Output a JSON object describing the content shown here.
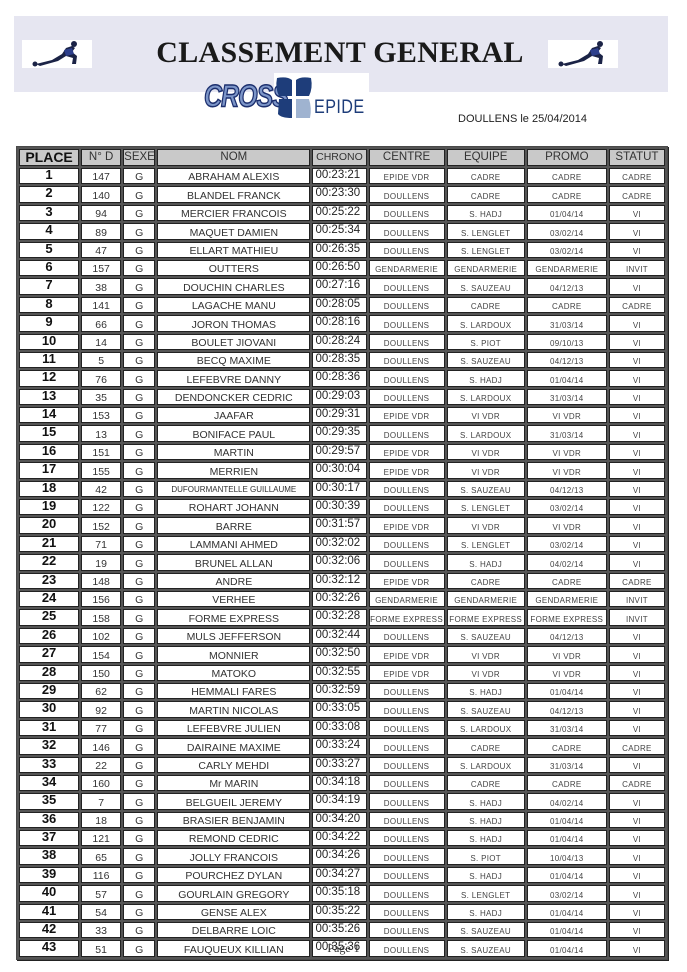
{
  "header": {
    "title": "CLASSEMENT GENERAL",
    "logo_text_cross": "CROSS",
    "logo_text_epide": "EPIDE",
    "location_date": "DOULLENS le 25/04/2014",
    "left_image": "runner-stretch-image",
    "right_image": "runner-stretch-image"
  },
  "colors": {
    "banner": "#e6e6f1",
    "header_cell": "#c9c9c9",
    "epide_dark_blue": "#1e3d7a",
    "epide_light_blue": "#9fb3d0",
    "cross_fill": "#7c95c8"
  },
  "table": {
    "columns": [
      "PLACE",
      "N° D",
      "SEXE",
      "NOM",
      "CHRONO",
      "CENTRE",
      "EQUIPE",
      "PROMO",
      "STATUT"
    ],
    "rows": [
      {
        "place": "1",
        "nd": "147",
        "sexe": "G",
        "nom": "ABRAHAM ALEXIS",
        "chrono": "00:23:21",
        "centre": "EPIDE VDR",
        "equipe": "CADRE",
        "promo": "CADRE",
        "statut": "CADRE"
      },
      {
        "place": "2",
        "nd": "140",
        "sexe": "G",
        "nom": "BLANDEL FRANCK",
        "chrono": "00:23:30",
        "centre": "DOULLENS",
        "equipe": "CADRE",
        "promo": "CADRE",
        "statut": "CADRE"
      },
      {
        "place": "3",
        "nd": "94",
        "sexe": "G",
        "nom": "MERCIER FRANCOIS",
        "chrono": "00:25:22",
        "centre": "DOULLENS",
        "equipe": "S. HADJ",
        "promo": "01/04/14",
        "statut": "VI"
      },
      {
        "place": "4",
        "nd": "89",
        "sexe": "G",
        "nom": "MAQUET DAMIEN",
        "chrono": "00:25:34",
        "centre": "DOULLENS",
        "equipe": "S. LENGLET",
        "promo": "03/02/14",
        "statut": "VI"
      },
      {
        "place": "5",
        "nd": "47",
        "sexe": "G",
        "nom": "ELLART MATHIEU",
        "chrono": "00:26:35",
        "centre": "DOULLENS",
        "equipe": "S. LENGLET",
        "promo": "03/02/14",
        "statut": "VI"
      },
      {
        "place": "6",
        "nd": "157",
        "sexe": "G",
        "nom": "OUTTERS",
        "chrono": "00:26:50",
        "centre": "GENDARMERIE",
        "equipe": "GENDARMERIE",
        "promo": "GENDARMERIE",
        "statut": "INVIT"
      },
      {
        "place": "7",
        "nd": "38",
        "sexe": "G",
        "nom": "DOUCHIN CHARLES",
        "chrono": "00:27:16",
        "centre": "DOULLENS",
        "equipe": "S. SAUZEAU",
        "promo": "04/12/13",
        "statut": "VI"
      },
      {
        "place": "8",
        "nd": "141",
        "sexe": "G",
        "nom": "LAGACHE MANU",
        "chrono": "00:28:05",
        "centre": "DOULLENS",
        "equipe": "CADRE",
        "promo": "CADRE",
        "statut": "CADRE"
      },
      {
        "place": "9",
        "nd": "66",
        "sexe": "G",
        "nom": "JORON THOMAS",
        "chrono": "00:28:16",
        "centre": "DOULLENS",
        "equipe": "S. LARDOUX",
        "promo": "31/03/14",
        "statut": "VI"
      },
      {
        "place": "10",
        "nd": "14",
        "sexe": "G",
        "nom": "BOULET JIOVANI",
        "chrono": "00:28:24",
        "centre": "DOULLENS",
        "equipe": "S. PIOT",
        "promo": "09/10/13",
        "statut": "VI"
      },
      {
        "place": "11",
        "nd": "5",
        "sexe": "G",
        "nom": "BECQ MAXIME",
        "chrono": "00:28:35",
        "centre": "DOULLENS",
        "equipe": "S. SAUZEAU",
        "promo": "04/12/13",
        "statut": "VI"
      },
      {
        "place": "12",
        "nd": "76",
        "sexe": "G",
        "nom": "LEFEBVRE DANNY",
        "chrono": "00:28:36",
        "centre": "DOULLENS",
        "equipe": "S. HADJ",
        "promo": "01/04/14",
        "statut": "VI"
      },
      {
        "place": "13",
        "nd": "35",
        "sexe": "G",
        "nom": "DENDONCKER CEDRIC",
        "chrono": "00:29:03",
        "centre": "DOULLENS",
        "equipe": "S. LARDOUX",
        "promo": "31/03/14",
        "statut": "VI"
      },
      {
        "place": "14",
        "nd": "153",
        "sexe": "G",
        "nom": "JAAFAR",
        "chrono": "00:29:31",
        "centre": "EPIDE VDR",
        "equipe": "VI VDR",
        "promo": "VI VDR",
        "statut": "VI"
      },
      {
        "place": "15",
        "nd": "13",
        "sexe": "G",
        "nom": "BONIFACE PAUL",
        "chrono": "00:29:35",
        "centre": "DOULLENS",
        "equipe": "S. LARDOUX",
        "promo": "31/03/14",
        "statut": "VI"
      },
      {
        "place": "16",
        "nd": "151",
        "sexe": "G",
        "nom": "MARTIN",
        "chrono": "00:29:57",
        "centre": "EPIDE VDR",
        "equipe": "VI VDR",
        "promo": "VI VDR",
        "statut": "VI"
      },
      {
        "place": "17",
        "nd": "155",
        "sexe": "G",
        "nom": "MERRIEN",
        "chrono": "00:30:04",
        "centre": "EPIDE VDR",
        "equipe": "VI VDR",
        "promo": "VI VDR",
        "statut": "VI"
      },
      {
        "place": "18",
        "nd": "42",
        "sexe": "G",
        "nom": "DUFOURMANTELLE GUILLAUME",
        "chrono": "00:30:17",
        "centre": "DOULLENS",
        "equipe": "S. SAUZEAU",
        "promo": "04/12/13",
        "statut": "VI"
      },
      {
        "place": "19",
        "nd": "122",
        "sexe": "G",
        "nom": "ROHART JOHANN",
        "chrono": "00:30:39",
        "centre": "DOULLENS",
        "equipe": "S. LENGLET",
        "promo": "03/02/14",
        "statut": "VI"
      },
      {
        "place": "20",
        "nd": "152",
        "sexe": "G",
        "nom": "BARRE",
        "chrono": "00:31:57",
        "centre": "EPIDE VDR",
        "equipe": "VI VDR",
        "promo": "VI VDR",
        "statut": "VI"
      },
      {
        "place": "21",
        "nd": "71",
        "sexe": "G",
        "nom": "LAMMANI AHMED",
        "chrono": "00:32:02",
        "centre": "DOULLENS",
        "equipe": "S. LENGLET",
        "promo": "03/02/14",
        "statut": "VI"
      },
      {
        "place": "22",
        "nd": "19",
        "sexe": "G",
        "nom": "BRUNEL ALLAN",
        "chrono": "00:32:06",
        "centre": "DOULLENS",
        "equipe": "S. HADJ",
        "promo": "04/02/14",
        "statut": "VI"
      },
      {
        "place": "23",
        "nd": "148",
        "sexe": "G",
        "nom": "ANDRE",
        "chrono": "00:32:12",
        "centre": "EPIDE VDR",
        "equipe": "CADRE",
        "promo": "CADRE",
        "statut": "CADRE"
      },
      {
        "place": "24",
        "nd": "156",
        "sexe": "G",
        "nom": "VERHEE",
        "chrono": "00:32:26",
        "centre": "GENDARMERIE",
        "equipe": "GENDARMERIE",
        "promo": "GENDARMERIE",
        "statut": "INVIT"
      },
      {
        "place": "25",
        "nd": "158",
        "sexe": "G",
        "nom": "FORME EXPRESS",
        "chrono": "00:32:28",
        "centre": "FORME EXPRESS",
        "equipe": "FORME EXPRESS",
        "promo": "FORME EXPRESS",
        "statut": "INVIT"
      },
      {
        "place": "26",
        "nd": "102",
        "sexe": "G",
        "nom": "MULS JEFFERSON",
        "chrono": "00:32:44",
        "centre": "DOULLENS",
        "equipe": "S. SAUZEAU",
        "promo": "04/12/13",
        "statut": "VI"
      },
      {
        "place": "27",
        "nd": "154",
        "sexe": "G",
        "nom": "MONNIER",
        "chrono": "00:32:50",
        "centre": "EPIDE VDR",
        "equipe": "VI VDR",
        "promo": "VI VDR",
        "statut": "VI"
      },
      {
        "place": "28",
        "nd": "150",
        "sexe": "G",
        "nom": "MATOKO",
        "chrono": "00:32:55",
        "centre": "EPIDE VDR",
        "equipe": "VI VDR",
        "promo": "VI VDR",
        "statut": "VI"
      },
      {
        "place": "29",
        "nd": "62",
        "sexe": "G",
        "nom": "HEMMALI FARES",
        "chrono": "00:32:59",
        "centre": "DOULLENS",
        "equipe": "S. HADJ",
        "promo": "01/04/14",
        "statut": "VI"
      },
      {
        "place": "30",
        "nd": "92",
        "sexe": "G",
        "nom": "MARTIN NICOLAS",
        "chrono": "00:33:05",
        "centre": "DOULLENS",
        "equipe": "S. SAUZEAU",
        "promo": "04/12/13",
        "statut": "VI"
      },
      {
        "place": "31",
        "nd": "77",
        "sexe": "G",
        "nom": "LEFEBVRE JULIEN",
        "chrono": "00:33:08",
        "centre": "DOULLENS",
        "equipe": "S. LARDOUX",
        "promo": "31/03/14",
        "statut": "VI"
      },
      {
        "place": "32",
        "nd": "146",
        "sexe": "G",
        "nom": "DAIRAINE MAXIME",
        "chrono": "00:33:24",
        "centre": "DOULLENS",
        "equipe": "CADRE",
        "promo": "CADRE",
        "statut": "CADRE"
      },
      {
        "place": "33",
        "nd": "22",
        "sexe": "G",
        "nom": "CARLY MEHDI",
        "chrono": "00:33:27",
        "centre": "DOULLENS",
        "equipe": "S. LARDOUX",
        "promo": "31/03/14",
        "statut": "VI"
      },
      {
        "place": "34",
        "nd": "160",
        "sexe": "G",
        "nom": "Mr MARIN",
        "chrono": "00:34:18",
        "centre": "DOULLENS",
        "equipe": "CADRE",
        "promo": "CADRE",
        "statut": "CADRE"
      },
      {
        "place": "35",
        "nd": "7",
        "sexe": "G",
        "nom": "BELGUEIL JEREMY",
        "chrono": "00:34:19",
        "centre": "DOULLENS",
        "equipe": "S. HADJ",
        "promo": "04/02/14",
        "statut": "VI"
      },
      {
        "place": "36",
        "nd": "18",
        "sexe": "G",
        "nom": "BRASIER BENJAMIN",
        "chrono": "00:34:20",
        "centre": "DOULLENS",
        "equipe": "S. HADJ",
        "promo": "01/04/14",
        "statut": "VI"
      },
      {
        "place": "37",
        "nd": "121",
        "sexe": "G",
        "nom": "REMOND CEDRIC",
        "chrono": "00:34:22",
        "centre": "DOULLENS",
        "equipe": "S. HADJ",
        "promo": "01/04/14",
        "statut": "VI"
      },
      {
        "place": "38",
        "nd": "65",
        "sexe": "G",
        "nom": "JOLLY FRANCOIS",
        "chrono": "00:34:26",
        "centre": "DOULLENS",
        "equipe": "S. PIOT",
        "promo": "10/04/13",
        "statut": "VI"
      },
      {
        "place": "39",
        "nd": "116",
        "sexe": "G",
        "nom": "POURCHEZ DYLAN",
        "chrono": "00:34:27",
        "centre": "DOULLENS",
        "equipe": "S. HADJ",
        "promo": "01/04/14",
        "statut": "VI"
      },
      {
        "place": "40",
        "nd": "57",
        "sexe": "G",
        "nom": "GOURLAIN GREGORY",
        "chrono": "00:35:18",
        "centre": "DOULLENS",
        "equipe": "S. LENGLET",
        "promo": "03/02/14",
        "statut": "VI"
      },
      {
        "place": "41",
        "nd": "54",
        "sexe": "G",
        "nom": "GENSE ALEX",
        "chrono": "00:35:22",
        "centre": "DOULLENS",
        "equipe": "S. HADJ",
        "promo": "01/04/14",
        "statut": "VI"
      },
      {
        "place": "42",
        "nd": "33",
        "sexe": "G",
        "nom": "DELBARRE LOIC",
        "chrono": "00:35:26",
        "centre": "DOULLENS",
        "equipe": "S. SAUZEAU",
        "promo": "01/04/14",
        "statut": "VI"
      },
      {
        "place": "43",
        "nd": "51",
        "sexe": "G",
        "nom": "FAUQUEUX KILLIAN",
        "chrono": "00:35:36",
        "centre": "DOULLENS",
        "equipe": "S. SAUZEAU",
        "promo": "01/04/14",
        "statut": "VI"
      }
    ]
  },
  "footer": {
    "page_label": "Page 1"
  }
}
